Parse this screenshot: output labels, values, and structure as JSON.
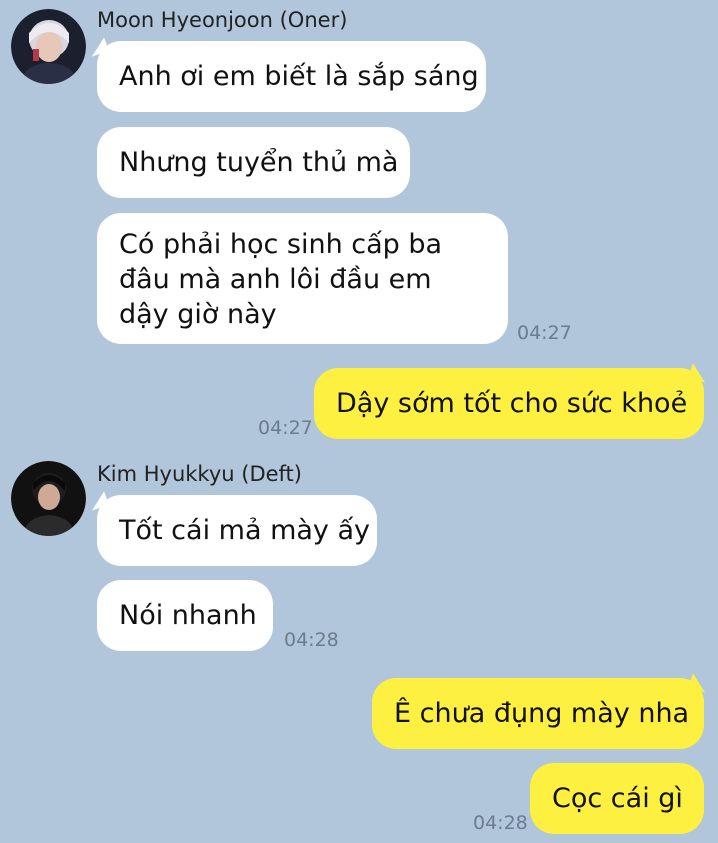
{
  "messages": [
    {
      "sender": "Moon Hyeonjoon (Oner)",
      "text": "Anh ơi em biết là sắp sáng"
    },
    {
      "text": "Nhưng tuyển thủ mà"
    },
    {
      "text": "Có phải học sinh cấp ba đâu mà anh lôi đầu em dậy giờ này",
      "time": "04:27"
    },
    {
      "text": "Dậy sớm tốt cho sức khoẻ",
      "time": "04:27"
    },
    {
      "sender": "Kim Hyukkyu (Deft)",
      "text": "Tốt cái mả mày ấy"
    },
    {
      "text": "Nói nhanh",
      "time": "04:28"
    },
    {
      "text": "Ê chưa đụng mày nha"
    },
    {
      "text": "Cọc cái gì",
      "time": "04:28"
    }
  ]
}
